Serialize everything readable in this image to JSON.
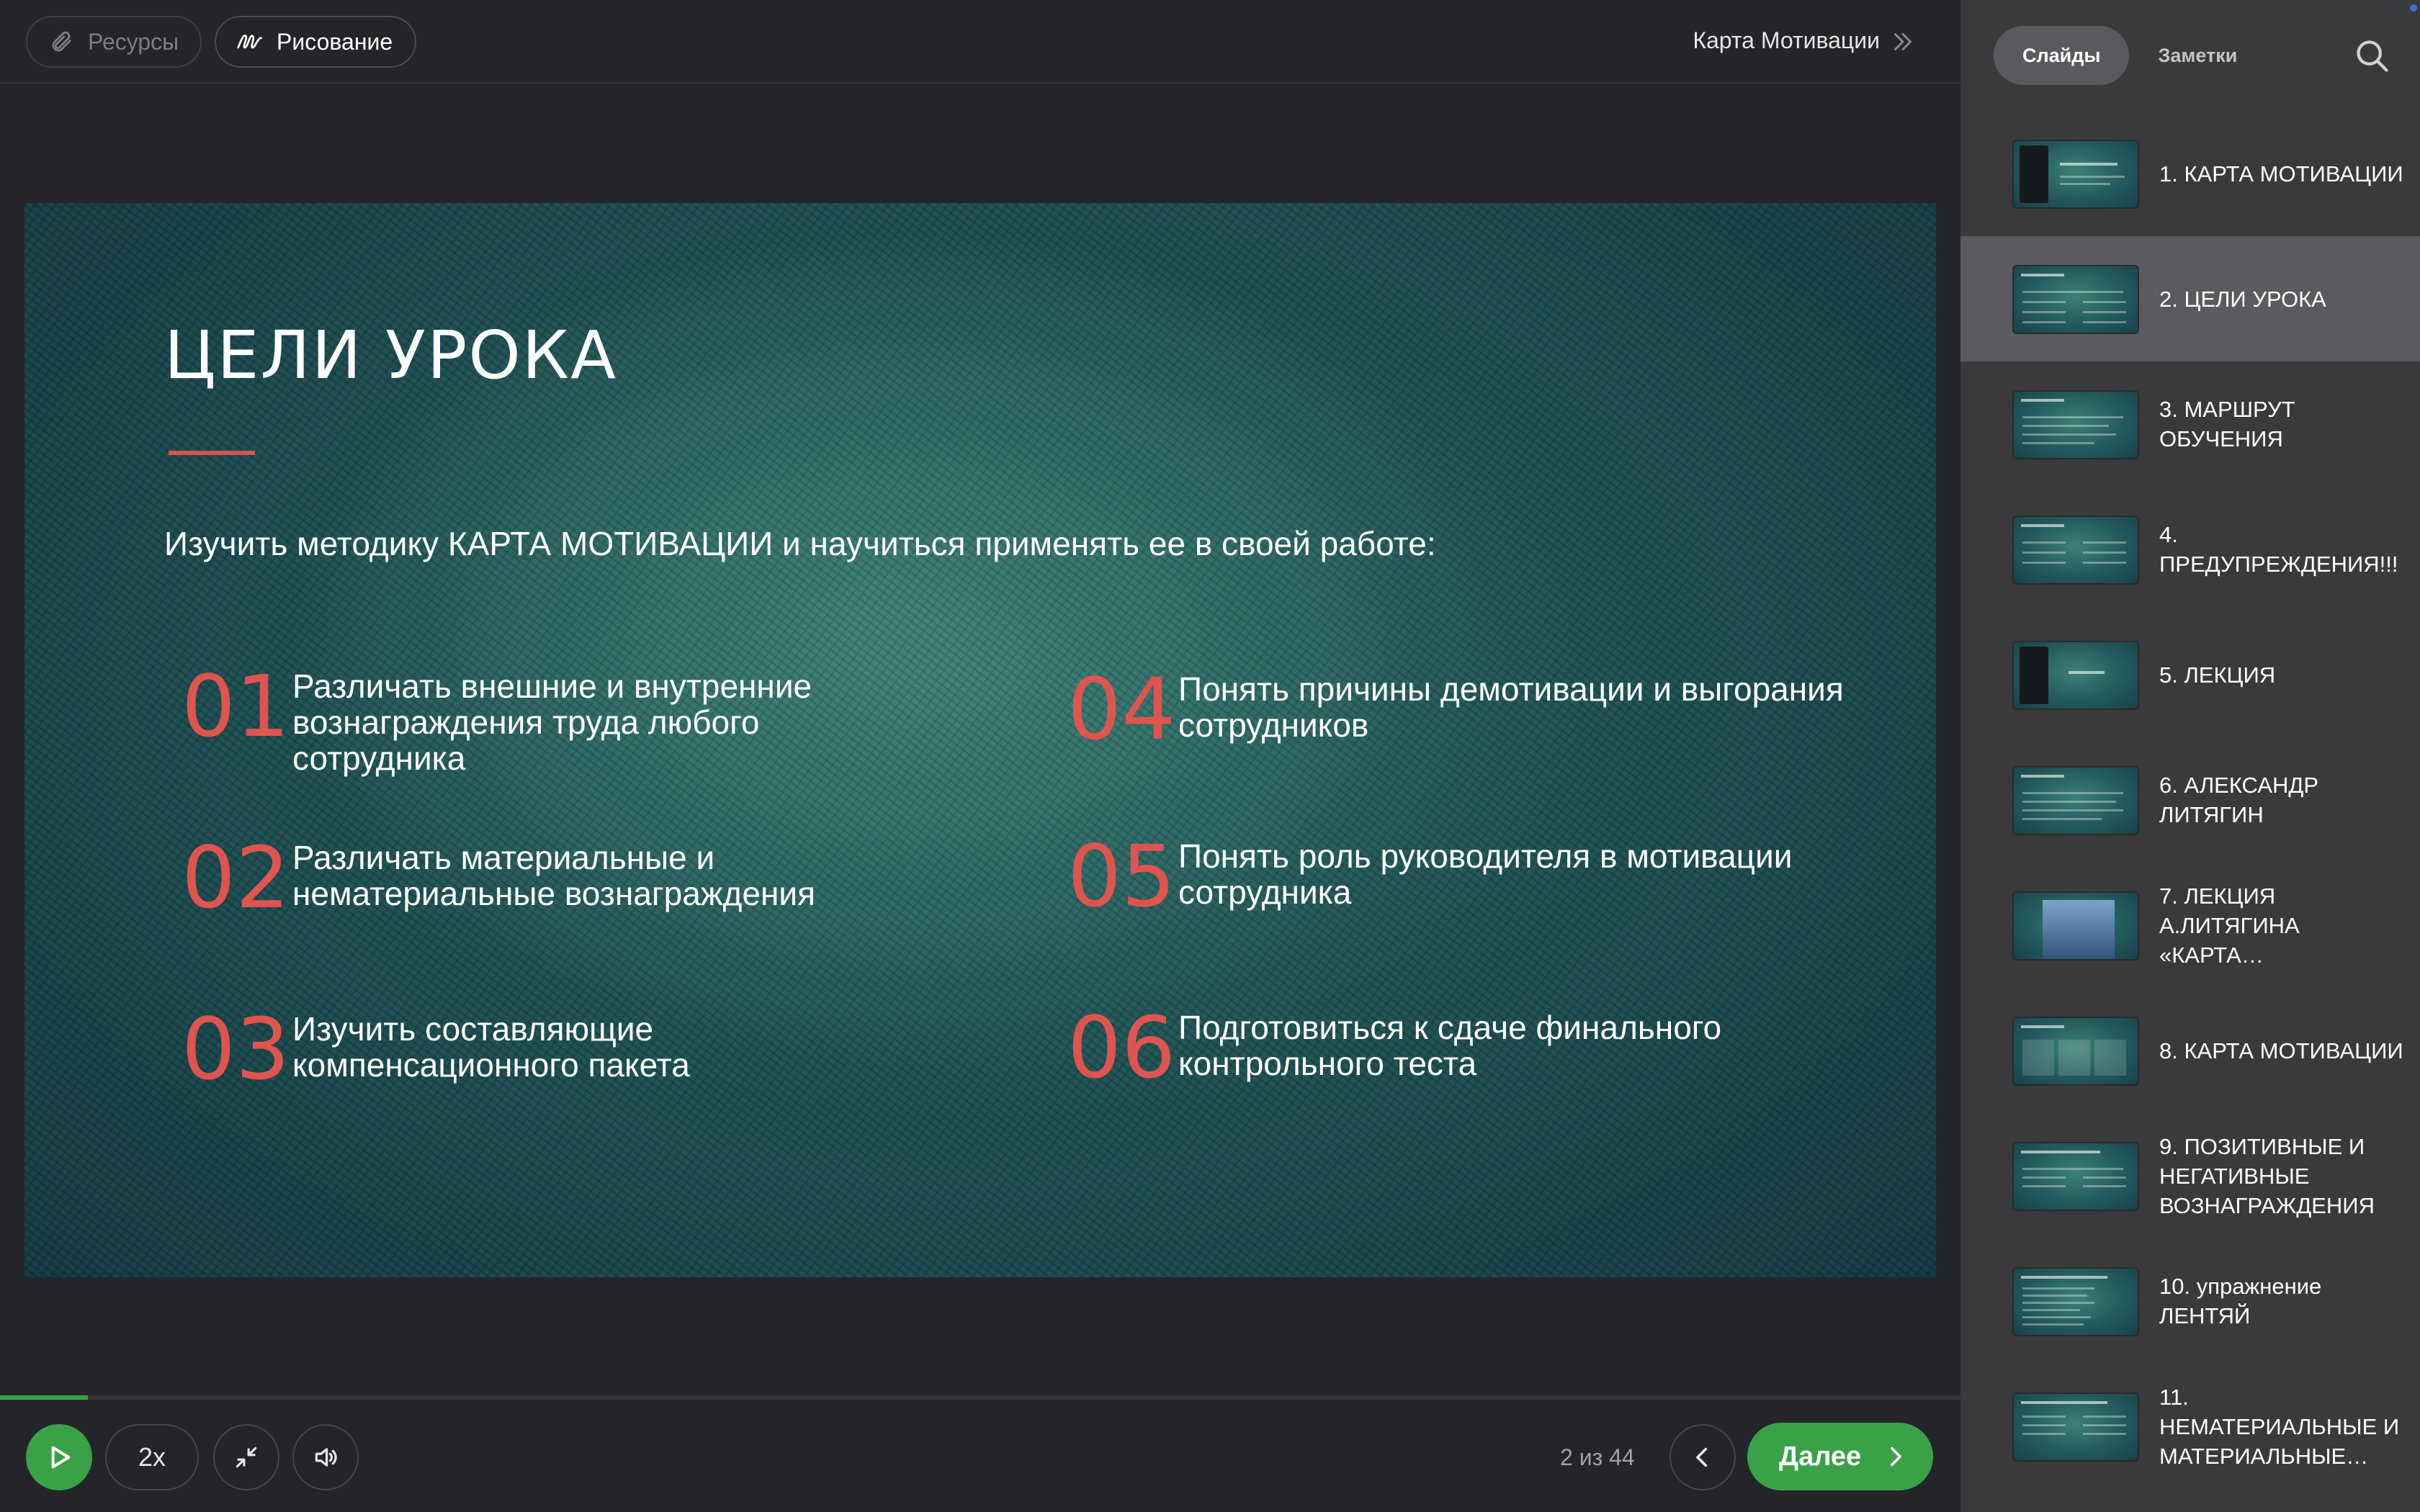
{
  "toolbar": {
    "resources_label": "Ресурсы",
    "draw_label": "Рисование",
    "course_title": "Карта Мотивации"
  },
  "slide": {
    "title": "ЦЕЛИ УРОКА",
    "intro": "Изучить методику КАРТА МОТИВАЦИИ и научиться применять ее в своей работе:",
    "goals": [
      {
        "num": "01",
        "text": "Различать  внешние и внутренние вознаграждения труда любого сотрудника"
      },
      {
        "num": "02",
        "text": "Различать материальные и нематериальные вознаграждения"
      },
      {
        "num": "03",
        "text": "Изучить составляющие компенсационного пакета"
      },
      {
        "num": "04",
        "text": "Понять причины демотивации и выгорания сотрудников"
      },
      {
        "num": "05",
        "text": "Понять роль руководителя в мотивации сотрудника"
      },
      {
        "num": "06",
        "text": "Подготовиться к сдаче финального контрольного теста"
      }
    ],
    "accent_color": "#e0544f"
  },
  "player": {
    "progress_fraction": 0.045,
    "speed_label": "2x",
    "counter": "2 из 44",
    "next_label": "Далее",
    "accent_color": "#3aa246"
  },
  "sidebar": {
    "tabs": [
      {
        "label": "Слайды",
        "active": true
      },
      {
        "label": "Заметки",
        "active": false
      }
    ],
    "items": [
      {
        "label": "1. КАРТА МОТИВАЦИИ",
        "thumb": "cover"
      },
      {
        "label": "2. ЦЕЛИ УРОКА",
        "thumb": "text",
        "active": true
      },
      {
        "label": "3. МАРШРУТ ОБУЧЕНИЯ",
        "thumb": "text"
      },
      {
        "label": "4. ПРЕДУПРЕЖДЕНИЯ!!!",
        "thumb": "text"
      },
      {
        "label": "5. ЛЕКЦИЯ",
        "thumb": "cover"
      },
      {
        "label": "6. АЛЕКСАНДР ЛИТЯГИН",
        "thumb": "text"
      },
      {
        "label": "7. ЛЕКЦИЯ А.ЛИТЯГИНА «КАРТА…",
        "thumb": "video"
      },
      {
        "label": "8. КАРТА МОТИВАЦИИ",
        "thumb": "text"
      },
      {
        "label": "9. ПОЗИТИВНЫЕ И НЕГАТИВНЫЕ ВОЗНАГРАЖДЕНИЯ",
        "thumb": "text"
      },
      {
        "label": "10. упражнение ЛЕНТЯЙ",
        "thumb": "text"
      },
      {
        "label": "11. НЕМАТЕРИАЛЬНЫЕ И МАТЕРИАЛЬНЫЕ…",
        "thumb": "text"
      }
    ]
  }
}
